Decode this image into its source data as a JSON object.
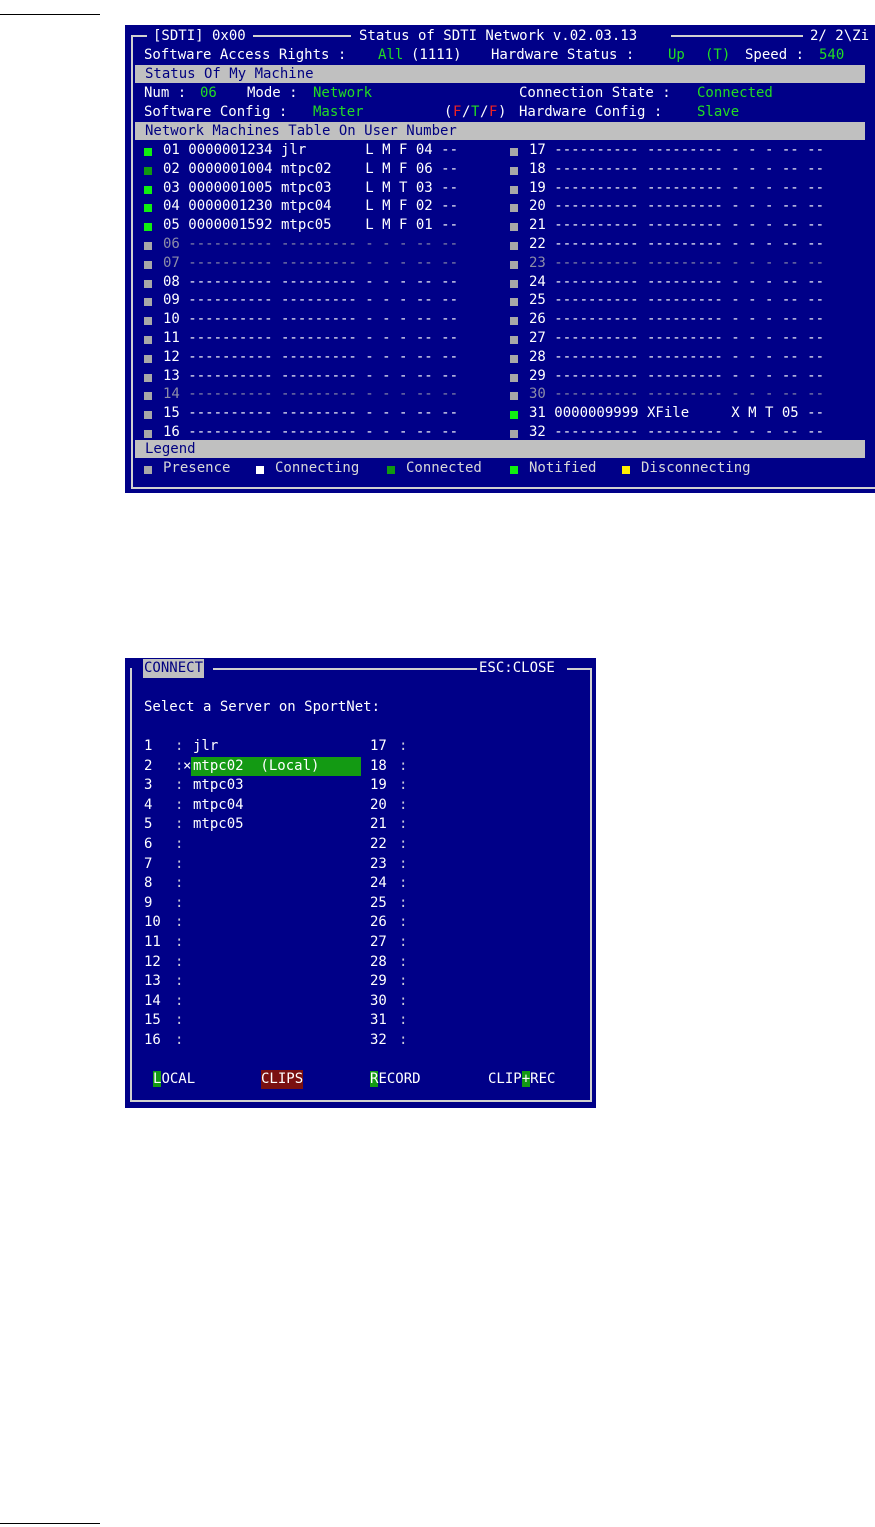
{
  "status": {
    "title_left": "[SDTI] 0x00",
    "title_center": "Status of SDTI Network v.02.03.13",
    "title_right": "2/ 2\\Zi",
    "line1": {
      "sw_rights_label": "Software Access Rights :",
      "sw_rights_value": "All",
      "sw_rights_code": "(1111)",
      "hw_status_label": "Hardware Status :",
      "hw_status_value": "Up",
      "hw_status_flag": "(T)",
      "speed_label": "Speed :",
      "speed_value": "540"
    },
    "my_machine_header": "Status Of My Machine",
    "my_machine": {
      "num_label": "Num :",
      "num_value": "06",
      "mode_label": "Mode :",
      "mode_value": "Network",
      "conn_state_label": "Connection State :",
      "conn_state_value": "Connected",
      "sw_config_label": "Software Config :",
      "sw_config_value": "Master",
      "ftf_open": "(",
      "ftf_f1": "F",
      "ftf_slash1": "/",
      "ftf_t": "T",
      "ftf_slash2": "/",
      "ftf_f2": "F",
      "ftf_close": ")",
      "hw_config_label": "Hardware Config :",
      "hw_config_value": "Slave"
    },
    "table_header": "Network Machines Table On User Number",
    "left_rows": [
      {
        "text": "01 0000001234 jlr       L M F 04 --",
        "sq": "s-gr",
        "dim": false
      },
      {
        "text": "02 0000001004 mtpc02    L M F 06 --",
        "sq": "s-dk",
        "dim": false
      },
      {
        "text": "03 0000001005 mtpc03    L M T 03 --",
        "sq": "s-gr",
        "dim": false
      },
      {
        "text": "04 0000001230 mtpc04    L M F 02 --",
        "sq": "s-gr",
        "dim": false
      },
      {
        "text": "05 0000001592 mtpc05    L M F 01 --",
        "sq": "s-gr",
        "dim": false
      },
      {
        "text": "06 ---------- --------- - - - -- --",
        "sq": "s-gray",
        "dim": true
      },
      {
        "text": "07 ---------- --------- - - - -- --",
        "sq": "s-gray",
        "dim": true
      },
      {
        "text": "08 ---------- --------- - - - -- --",
        "sq": "s-gray",
        "dim": false
      },
      {
        "text": "09 ---------- --------- - - - -- --",
        "sq": "s-gray",
        "dim": false
      },
      {
        "text": "10 ---------- --------- - - - -- --",
        "sq": "s-gray",
        "dim": false
      },
      {
        "text": "11 ---------- --------- - - - -- --",
        "sq": "s-gray",
        "dim": false
      },
      {
        "text": "12 ---------- --------- - - - -- --",
        "sq": "s-gray",
        "dim": false
      },
      {
        "text": "13 ---------- --------- - - - -- --",
        "sq": "s-gray",
        "dim": false
      },
      {
        "text": "14 ---------- --------- - - - -- --",
        "sq": "s-gray",
        "dim": true
      },
      {
        "text": "15 ---------- --------- - - - -- --",
        "sq": "s-gray",
        "dim": false
      },
      {
        "text": "16 ---------- --------- - - - -- --",
        "sq": "s-gray",
        "dim": false
      }
    ],
    "right_rows": [
      {
        "text": "17 ---------- --------- - - - -- --",
        "sq": "s-gray",
        "dim": false
      },
      {
        "text": "18 ---------- --------- - - - -- --",
        "sq": "s-gray",
        "dim": false
      },
      {
        "text": "19 ---------- --------- - - - -- --",
        "sq": "s-gray",
        "dim": false
      },
      {
        "text": "20 ---------- --------- - - - -- --",
        "sq": "s-gray",
        "dim": false
      },
      {
        "text": "21 ---------- --------- - - - -- --",
        "sq": "s-gray",
        "dim": false
      },
      {
        "text": "22 ---------- --------- - - - -- --",
        "sq": "s-gray",
        "dim": false
      },
      {
        "text": "23 ---------- --------- - - - -- --",
        "sq": "s-gray",
        "dim": true
      },
      {
        "text": "24 ---------- --------- - - - -- --",
        "sq": "s-gray",
        "dim": false
      },
      {
        "text": "25 ---------- --------- - - - -- --",
        "sq": "s-gray",
        "dim": false
      },
      {
        "text": "26 ---------- --------- - - - -- --",
        "sq": "s-gray",
        "dim": false
      },
      {
        "text": "27 ---------- --------- - - - -- --",
        "sq": "s-gray",
        "dim": false
      },
      {
        "text": "28 ---------- --------- - - - -- --",
        "sq": "s-gray",
        "dim": false
      },
      {
        "text": "29 ---------- --------- - - - -- --",
        "sq": "s-gray",
        "dim": false
      },
      {
        "text": "30 ---------- --------- - - - -- --",
        "sq": "s-gray",
        "dim": true
      },
      {
        "text": "31 0000009999 XFile     X M T 05 --",
        "sq": "s-gr",
        "dim": false
      },
      {
        "text": "32 ---------- --------- - - - -- --",
        "sq": "s-gray",
        "dim": false
      }
    ],
    "legend_header": "Legend",
    "legend": [
      {
        "label": "Presence",
        "sq": "s-gray"
      },
      {
        "label": "Connecting",
        "sq": "s-white"
      },
      {
        "label": "Connected",
        "sq": "s-dk"
      },
      {
        "label": "Notified",
        "sq": "s-gr"
      },
      {
        "label": "Disconnecting",
        "sq": "s-yl"
      }
    ]
  },
  "connect": {
    "title": "CONNECT",
    "close_hint": "ESC:CLOSE",
    "prompt": "Select a Server on SportNet:",
    "left_items": [
      {
        "num": "1",
        "sep": ":",
        "mark": "",
        "name": "jlr"
      },
      {
        "num": "2",
        "sep": ":",
        "mark": "×",
        "name": "mtpc02  (Local)"
      },
      {
        "num": "3",
        "sep": ":",
        "mark": "",
        "name": "mtpc03"
      },
      {
        "num": "4",
        "sep": ":",
        "mark": "",
        "name": "mtpc04"
      },
      {
        "num": "5",
        "sep": ":",
        "mark": "",
        "name": "mtpc05"
      },
      {
        "num": "6",
        "sep": ":",
        "mark": "",
        "name": ""
      },
      {
        "num": "7",
        "sep": ":",
        "mark": "",
        "name": ""
      },
      {
        "num": "8",
        "sep": ":",
        "mark": "",
        "name": ""
      },
      {
        "num": "9",
        "sep": ":",
        "mark": "",
        "name": ""
      },
      {
        "num": "10",
        "sep": ":",
        "mark": "",
        "name": ""
      },
      {
        "num": "11",
        "sep": ":",
        "mark": "",
        "name": ""
      },
      {
        "num": "12",
        "sep": ":",
        "mark": "",
        "name": ""
      },
      {
        "num": "13",
        "sep": ":",
        "mark": "",
        "name": ""
      },
      {
        "num": "14",
        "sep": ":",
        "mark": "",
        "name": ""
      },
      {
        "num": "15",
        "sep": ":",
        "mark": "",
        "name": ""
      },
      {
        "num": "16",
        "sep": ":",
        "mark": "",
        "name": ""
      }
    ],
    "right_items": [
      {
        "num": "17",
        "sep": ":"
      },
      {
        "num": "18",
        "sep": ":"
      },
      {
        "num": "19",
        "sep": ":"
      },
      {
        "num": "20",
        "sep": ":"
      },
      {
        "num": "21",
        "sep": ":"
      },
      {
        "num": "22",
        "sep": ":"
      },
      {
        "num": "23",
        "sep": ":"
      },
      {
        "num": "24",
        "sep": ":"
      },
      {
        "num": "25",
        "sep": ":"
      },
      {
        "num": "26",
        "sep": ":"
      },
      {
        "num": "27",
        "sep": ":"
      },
      {
        "num": "28",
        "sep": ":"
      },
      {
        "num": "29",
        "sep": ":"
      },
      {
        "num": "30",
        "sep": ":"
      },
      {
        "num": "31",
        "sep": ":"
      },
      {
        "num": "32",
        "sep": ":"
      }
    ],
    "buttons": {
      "local_key": "L",
      "local_rest": "OCAL",
      "clips": "CLIPS",
      "record_key": "R",
      "record_rest": "ECORD",
      "cliprec_pre": "CLIP",
      "cliprec_key": "+",
      "cliprec_post": "REC"
    }
  }
}
